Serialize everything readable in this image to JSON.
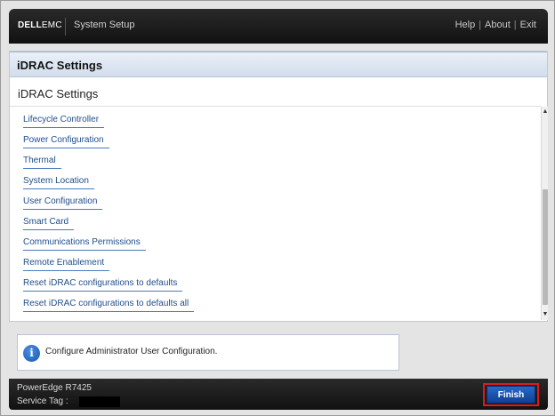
{
  "header": {
    "brand_dell": "DELL",
    "brand_emc": "EMC",
    "app_title": "System Setup",
    "links": [
      "Help",
      "About",
      "Exit"
    ],
    "separator": "|"
  },
  "panel": {
    "title": "iDRAC Settings",
    "section_title": "iDRAC Settings",
    "items": [
      {
        "label": "Lifecycle Controller"
      },
      {
        "label": "Power Configuration"
      },
      {
        "label": "Thermal"
      },
      {
        "label": "System Location"
      },
      {
        "label": "User Configuration"
      },
      {
        "label": "Smart Card"
      },
      {
        "label": "Communications Permissions"
      },
      {
        "label": "Remote Enablement"
      },
      {
        "label": "Reset iDRAC configurations to defaults"
      },
      {
        "label": "Reset iDRAC configurations to defaults all"
      }
    ],
    "scroll_up_glyph": "▲",
    "scroll_down_glyph": "▼"
  },
  "help": {
    "icon": "info-icon",
    "icon_glyph": "i",
    "text": "Configure Administrator User Configuration."
  },
  "footer": {
    "model": "PowerEdge R7425",
    "service_tag_label": "Service Tag :",
    "finish_label": "Finish"
  },
  "colors": {
    "header_bg": "#1a1a1a",
    "link_blue": "#1f4e8c",
    "finish_blue": "#1a52b0",
    "highlight_red": "#d81c1c"
  }
}
